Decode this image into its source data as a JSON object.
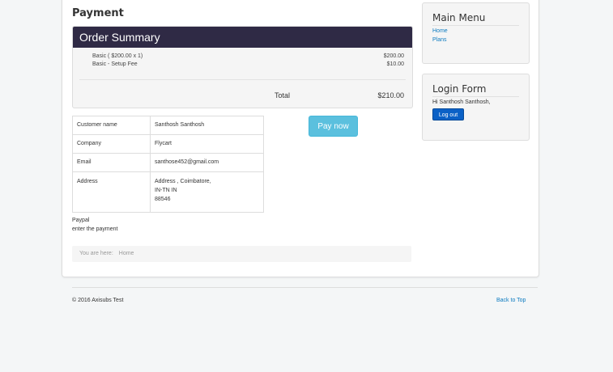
{
  "page": {
    "title": "Payment"
  },
  "order_summary": {
    "heading": "Order Summary",
    "items": [
      {
        "label": "Basic ( $200.00 x 1)",
        "amount": "$200.00"
      },
      {
        "label": "Basic - Setup Fee",
        "amount": "$10.00"
      }
    ],
    "total_label": "Total",
    "total_amount": "$210.00"
  },
  "customer": {
    "rows": [
      {
        "key": "Customer name",
        "value": "Santhosh Santhosh"
      },
      {
        "key": "Company",
        "value": "Flycart"
      },
      {
        "key": "Email",
        "value": "santhose452@gmail.com"
      }
    ],
    "address": {
      "key": "Address",
      "lines": [
        "Address , Coimbatore,",
        "IN-TN IN",
        "88546"
      ]
    }
  },
  "pay_button": {
    "label": "Pay now"
  },
  "payment_method": {
    "name": "Paypal",
    "note": "enter the payment"
  },
  "breadcrumb": {
    "label": "You are here:",
    "home": "Home"
  },
  "main_menu": {
    "title": "Main Menu",
    "items": [
      "Home",
      "Plans"
    ]
  },
  "login_form": {
    "title": "Login Form",
    "greeting": "Hi Santhosh Santhosh,",
    "logout_label": "Log out"
  },
  "footer": {
    "copyright": "© 2016 Axisubs Test",
    "back_to_top": "Back to Top"
  }
}
